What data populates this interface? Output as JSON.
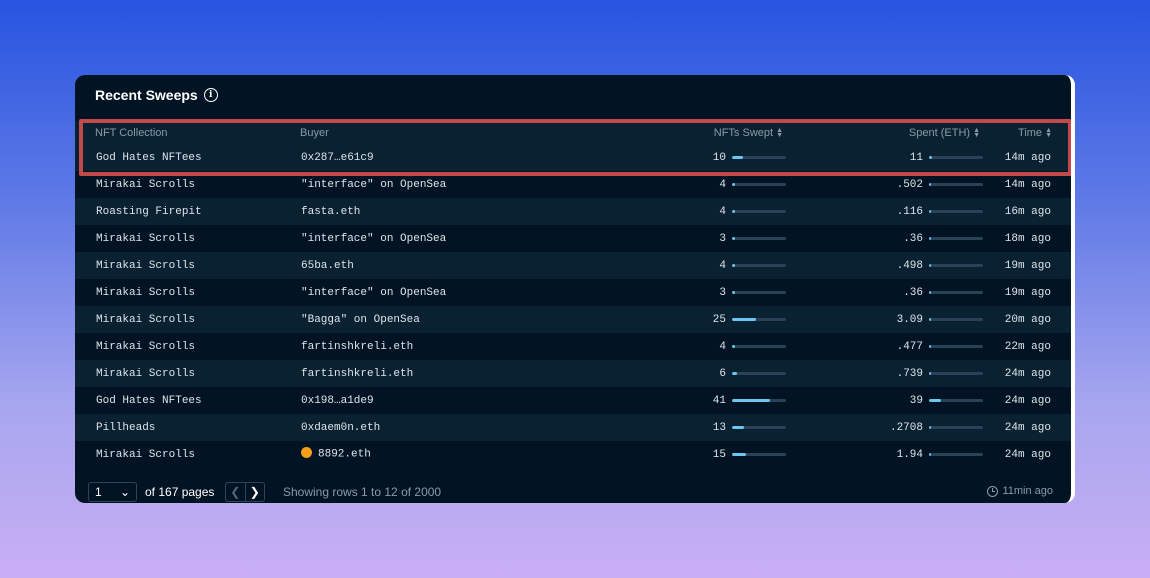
{
  "card": {
    "title": "Recent Sweeps",
    "info_icon": "i"
  },
  "columns": {
    "collection": "NFT Collection",
    "buyer": "Buyer",
    "nfts_swept": "NFTs Swept",
    "spent": "Spent (ETH)",
    "time": "Time"
  },
  "rows": [
    {
      "collection": "God Hates NFTees",
      "buyer": "0x287…e61c9",
      "nfts": "10",
      "nfts_frac": 0.2,
      "spent": "11",
      "spent_frac": 0.05,
      "time": "14m ago"
    },
    {
      "collection": "Mirakai Scrolls",
      "buyer": "\"interface\" on OpenSea",
      "nfts": "4",
      "nfts_frac": 0.06,
      "spent": ".502",
      "spent_frac": 0.02,
      "time": "14m ago"
    },
    {
      "collection": "Roasting Firepit",
      "buyer": "fasta.eth",
      "nfts": "4",
      "nfts_frac": 0.06,
      "spent": ".116",
      "spent_frac": 0.02,
      "time": "16m ago"
    },
    {
      "collection": "Mirakai Scrolls",
      "buyer": "\"interface\" on OpenSea",
      "nfts": "3",
      "nfts_frac": 0.05,
      "spent": ".36",
      "spent_frac": 0.02,
      "time": "18m ago"
    },
    {
      "collection": "Mirakai Scrolls",
      "buyer": "65ba.eth",
      "nfts": "4",
      "nfts_frac": 0.06,
      "spent": ".498",
      "spent_frac": 0.02,
      "time": "19m ago"
    },
    {
      "collection": "Mirakai Scrolls",
      "buyer": "\"interface\" on OpenSea",
      "nfts": "3",
      "nfts_frac": 0.05,
      "spent": ".36",
      "spent_frac": 0.02,
      "time": "19m ago"
    },
    {
      "collection": "Mirakai Scrolls",
      "buyer": "\"Bagga\" on OpenSea",
      "nfts": "25",
      "nfts_frac": 0.44,
      "spent": "3.09",
      "spent_frac": 0.03,
      "time": "20m ago"
    },
    {
      "collection": "Mirakai Scrolls",
      "buyer": "fartinshkreli.eth",
      "nfts": "4",
      "nfts_frac": 0.06,
      "spent": ".477",
      "spent_frac": 0.02,
      "time": "22m ago"
    },
    {
      "collection": "Mirakai Scrolls",
      "buyer": "fartinshkreli.eth",
      "nfts": "6",
      "nfts_frac": 0.1,
      "spent": ".739",
      "spent_frac": 0.02,
      "time": "24m ago"
    },
    {
      "collection": "God Hates NFTees",
      "buyer": "0x198…a1de9",
      "nfts": "41",
      "nfts_frac": 0.7,
      "spent": "39",
      "spent_frac": 0.22,
      "time": "24m ago"
    },
    {
      "collection": "Pillheads",
      "buyer": "0xdaem0n.eth",
      "nfts": "13",
      "nfts_frac": 0.23,
      "spent": ".2708",
      "spent_frac": 0.02,
      "time": "24m ago"
    },
    {
      "collection": "Mirakai Scrolls",
      "buyer": "8892.eth",
      "buyer_icon": "smiling-face-icon",
      "nfts": "15",
      "nfts_frac": 0.25,
      "spent": "1.94",
      "spent_frac": 0.02,
      "time": "24m ago"
    }
  ],
  "footer": {
    "page_value": "1",
    "of_pages": "of 167 pages",
    "showing": "Showing rows 1 to 12 of 2000",
    "updated": "11min ago"
  },
  "colors": {
    "card_bg": "#021423",
    "row_alt_bg": "#0a2131",
    "bar_fill": "#6cc6f0",
    "highlight": "#c24a4a"
  }
}
